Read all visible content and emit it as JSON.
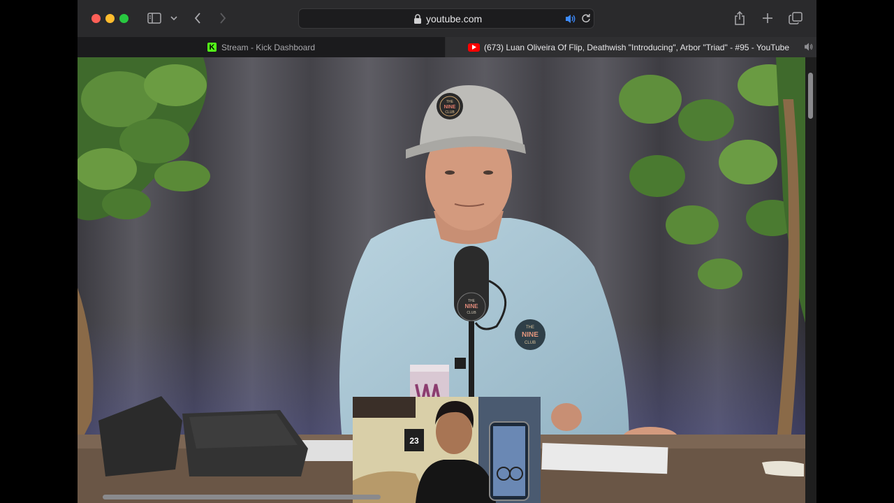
{
  "browser": {
    "address": "youtube.com",
    "icons": {
      "sidebar": "sidebar-icon",
      "back": "chevron-left-icon",
      "forward": "chevron-right-icon",
      "lock": "lock-icon",
      "sound": "speaker-icon",
      "reload": "reload-icon",
      "share": "share-icon",
      "new_tab": "plus-icon",
      "tab_overview": "tabs-icon"
    }
  },
  "tabs": [
    {
      "title": "Stream - Kick Dashboard",
      "icon": "kick-logo",
      "active": false
    },
    {
      "title": "(673) Luan Oliveira Of Flip, Deathwish \"Introducing\", Arbor \"Triad\" - #95 - YouTube",
      "icon": "youtube-logo",
      "active": true,
      "audio": true
    }
  ],
  "video": {
    "cap_logo_text": [
      "THE",
      "NINE",
      "CLUB"
    ],
    "shirt_logo_text": [
      "THE",
      "NINE",
      "CLUB"
    ],
    "mic_logo_text": [
      "THE",
      "NINE",
      "CLUB"
    ],
    "pip_jersey_number": "23"
  },
  "colors": {
    "toolbar_bg": "#2a2a2c",
    "tab_active_bg": "#2f2f31",
    "kick_green": "#53fc18",
    "youtube_red": "#ff0000"
  }
}
